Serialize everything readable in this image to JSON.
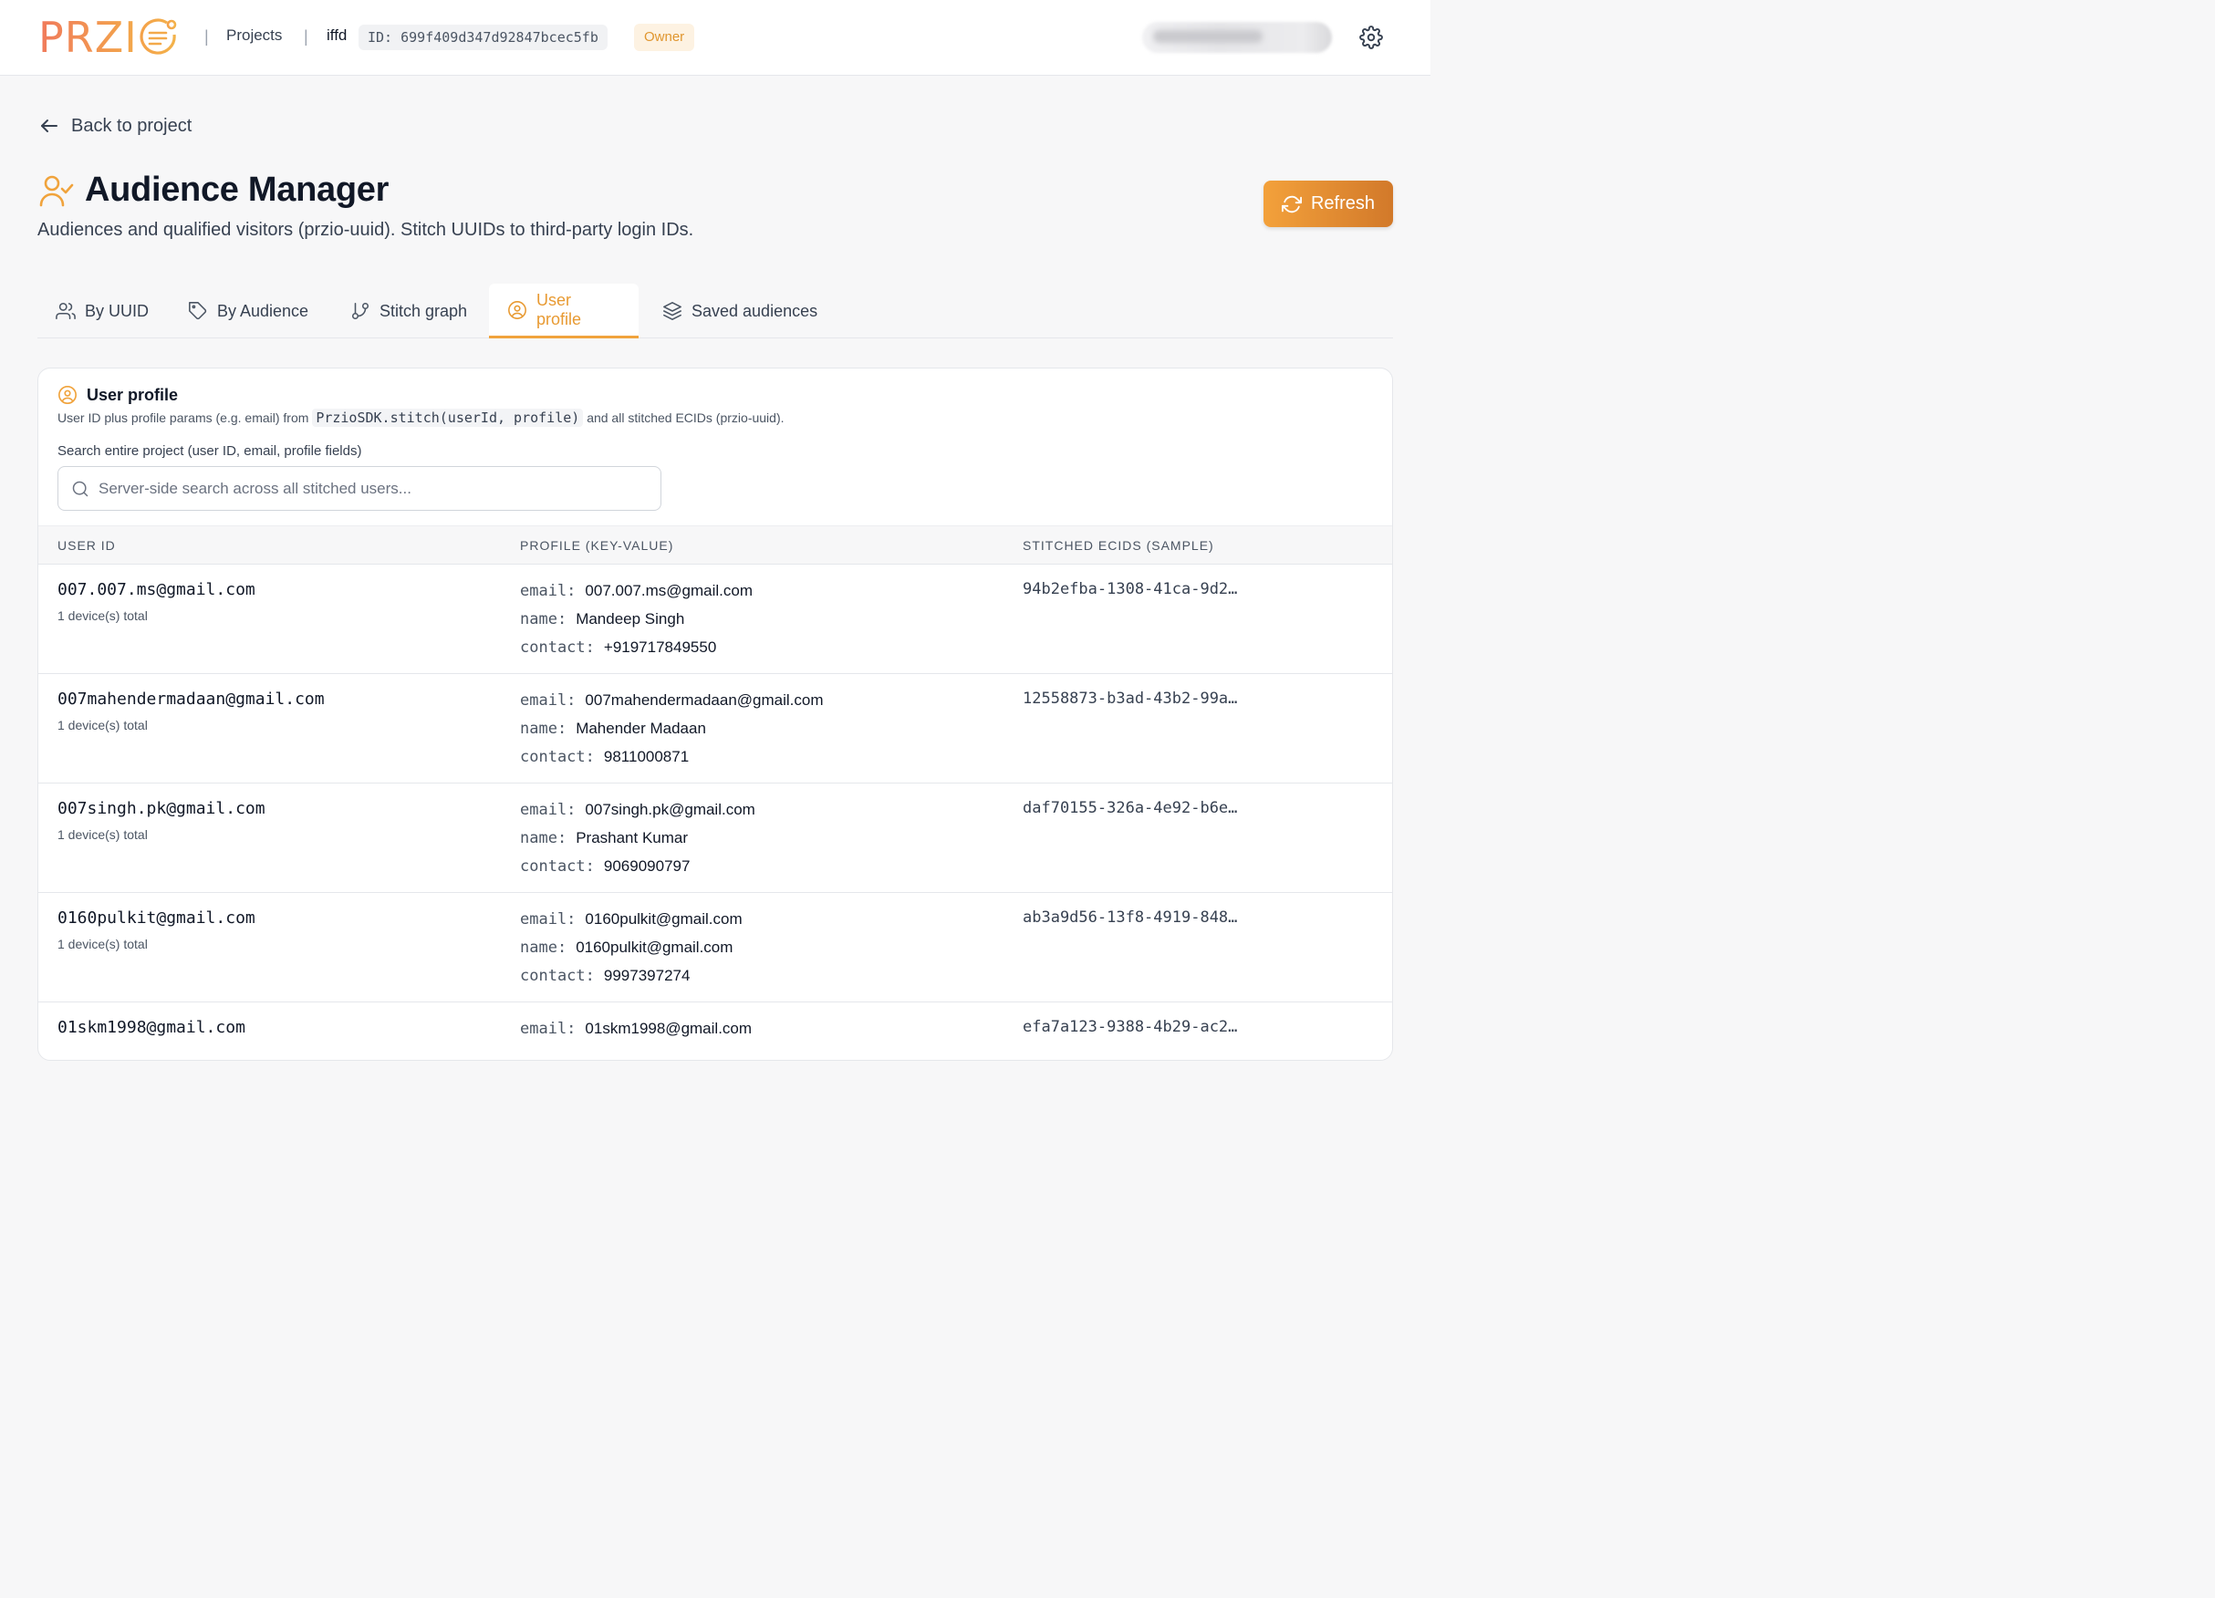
{
  "header": {
    "logo_text": "PRZI",
    "nav_projects": "Projects",
    "project_name": "iffd",
    "project_id": "ID: 699f409d347d92847bcec5fb",
    "role_badge": "Owner"
  },
  "back_link": "Back to project",
  "page": {
    "title": "Audience Manager",
    "subtitle": "Audiences and qualified visitors (przio-uuid). Stitch UUIDs to third-party login IDs.",
    "refresh_label": "Refresh"
  },
  "tabs": [
    {
      "label": "By UUID",
      "icon": "users-icon"
    },
    {
      "label": "By Audience",
      "icon": "tag-icon"
    },
    {
      "label": "Stitch graph",
      "icon": "git-branch-icon"
    },
    {
      "label": "User profile",
      "icon": "user-circle-icon",
      "active": true
    },
    {
      "label": "Saved audiences",
      "icon": "layers-icon"
    }
  ],
  "card": {
    "title": "User profile",
    "desc_before": "User ID plus profile params (e.g. email) from",
    "desc_code": "PrzioSDK.stitch(userId, profile)",
    "desc_after": "and all stitched ECIDs (przio-uuid).",
    "search_label": "Search entire project (user ID, email, profile fields)",
    "search_placeholder": "Server-side search across all stitched users..."
  },
  "table": {
    "columns": [
      "USER ID",
      "PROFILE (KEY-VALUE)",
      "STITCHED ECIDS (SAMPLE)"
    ],
    "rows": [
      {
        "user_id": "007.007.ms@gmail.com",
        "devices": "1 device(s) total",
        "email": "007.007.ms@gmail.com",
        "name": "Mandeep Singh",
        "contact": "+919717849550",
        "ecid": "94b2efba-1308-41ca-9d2…"
      },
      {
        "user_id": "007mahendermadaan@gmail.com",
        "devices": "1 device(s) total",
        "email": "007mahendermadaan@gmail.com",
        "name": "Mahender Madaan",
        "contact": "9811000871",
        "ecid": "12558873-b3ad-43b2-99a…"
      },
      {
        "user_id": "007singh.pk@gmail.com",
        "devices": "1 device(s) total",
        "email": "007singh.pk@gmail.com",
        "name": "Prashant Kumar",
        "contact": "9069090797",
        "ecid": "daf70155-326a-4e92-b6e…"
      },
      {
        "user_id": "0160pulkit@gmail.com",
        "devices": "1 device(s) total",
        "email": "0160pulkit@gmail.com",
        "name": "0160pulkit@gmail.com",
        "contact": "9997397274",
        "ecid": "ab3a9d56-13f8-4919-848…"
      },
      {
        "user_id": "01skm1998@gmail.com",
        "devices": "",
        "email": "01skm1998@gmail.com",
        "name": "",
        "contact": "",
        "ecid": "efa7a123-9388-4b29-ac2…"
      }
    ],
    "keys": {
      "email": "email:",
      "name": "name:",
      "contact": "contact:"
    }
  },
  "colors": {
    "accent": "#f0a33c",
    "accent_dark": "#d2792a",
    "owner_bg": "#fdf2e2"
  }
}
